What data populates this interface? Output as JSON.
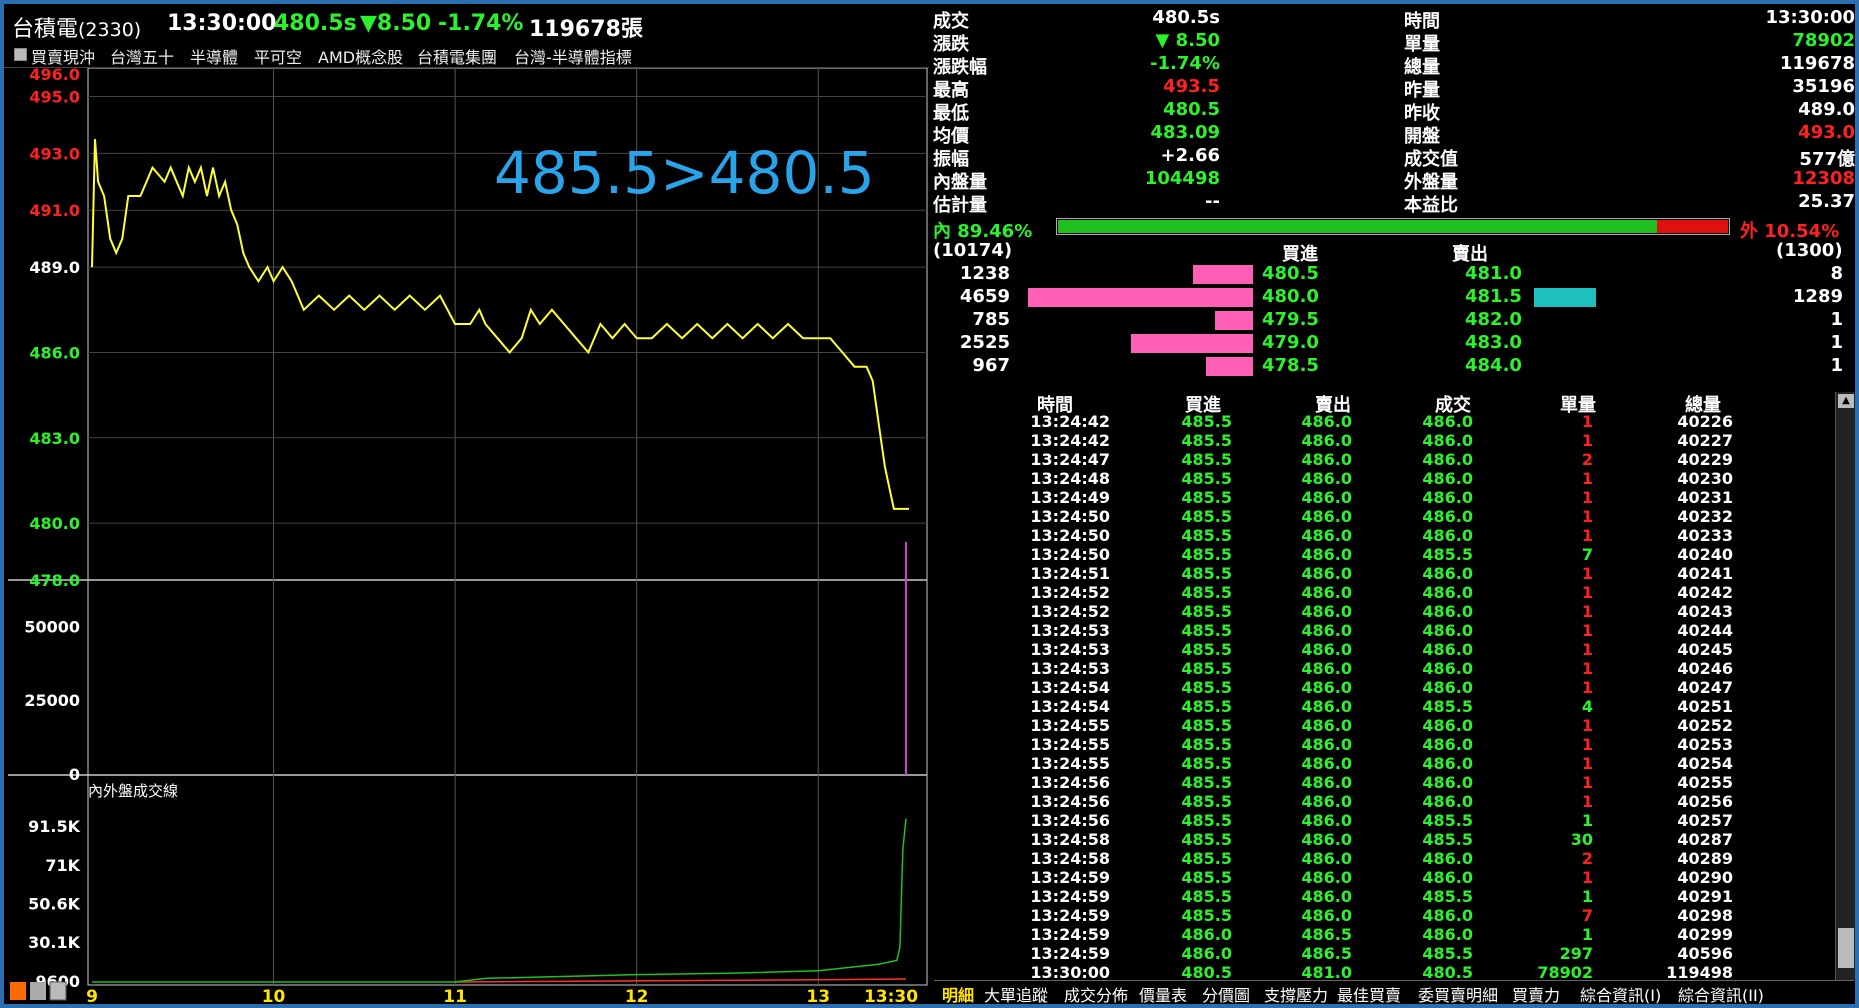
{
  "header": {
    "name": "台積電",
    "code": "(2330)",
    "time": "13:30:00",
    "price": "480.5s",
    "change": "▼8.50",
    "pct": "-1.74%",
    "volume": "119678張"
  },
  "tags": [
    "買賣現沖",
    "台灣五十",
    "半導體",
    "平可空",
    "AMD概念股",
    "台積電集團",
    "台灣-半導體指標"
  ],
  "annotation": "485.5>480.5",
  "price_axis": [
    "496.0",
    "495.0",
    "493.0",
    "491.0",
    "489.0",
    "486.0",
    "483.0",
    "480.0",
    "478.0"
  ],
  "volume_axis": [
    "50000",
    "25000",
    "0"
  ],
  "flow_axis": [
    "91.5K",
    "71K",
    "50.6K",
    "30.1K",
    "9600"
  ],
  "flow_title": "內外盤成交線",
  "time_axis": [
    "9",
    "10",
    "11",
    "12",
    "13",
    "13:30"
  ],
  "chart_data": {
    "type": "line",
    "price_line": [
      [
        "09:00",
        489.0
      ],
      [
        "09:01",
        493.5
      ],
      [
        "09:02",
        492.0
      ],
      [
        "09:04",
        491.5
      ],
      [
        "09:06",
        490.0
      ],
      [
        "09:08",
        489.5
      ],
      [
        "09:10",
        490.0
      ],
      [
        "09:12",
        491.5
      ],
      [
        "09:16",
        491.5
      ],
      [
        "09:18",
        492.0
      ],
      [
        "09:20",
        492.5
      ],
      [
        "09:24",
        492.0
      ],
      [
        "09:26",
        492.5
      ],
      [
        "09:28",
        492.0
      ],
      [
        "09:30",
        491.5
      ],
      [
        "09:32",
        492.5
      ],
      [
        "09:34",
        492.0
      ],
      [
        "09:36",
        492.5
      ],
      [
        "09:38",
        491.5
      ],
      [
        "09:40",
        492.5
      ],
      [
        "09:42",
        491.5
      ],
      [
        "09:44",
        492.0
      ],
      [
        "09:46",
        491.0
      ],
      [
        "09:48",
        490.5
      ],
      [
        "09:50",
        489.5
      ],
      [
        "09:52",
        489.0
      ],
      [
        "09:55",
        488.5
      ],
      [
        "09:58",
        489.0
      ],
      [
        "10:00",
        488.5
      ],
      [
        "10:03",
        489.0
      ],
      [
        "10:06",
        488.5
      ],
      [
        "10:08",
        488.0
      ],
      [
        "10:10",
        487.5
      ],
      [
        "10:15",
        488.0
      ],
      [
        "10:20",
        487.5
      ],
      [
        "10:25",
        488.0
      ],
      [
        "10:30",
        487.5
      ],
      [
        "10:35",
        488.0
      ],
      [
        "10:40",
        487.5
      ],
      [
        "10:45",
        488.0
      ],
      [
        "10:50",
        487.5
      ],
      [
        "10:55",
        488.0
      ],
      [
        "11:00",
        487.0
      ],
      [
        "11:05",
        487.0
      ],
      [
        "11:08",
        487.5
      ],
      [
        "11:10",
        487.0
      ],
      [
        "11:14",
        486.5
      ],
      [
        "11:18",
        486.0
      ],
      [
        "11:22",
        486.5
      ],
      [
        "11:25",
        487.5
      ],
      [
        "11:28",
        487.0
      ],
      [
        "11:32",
        487.5
      ],
      [
        "11:36",
        487.0
      ],
      [
        "11:40",
        486.5
      ],
      [
        "11:44",
        486.0
      ],
      [
        "11:48",
        487.0
      ],
      [
        "11:52",
        486.5
      ],
      [
        "11:56",
        487.0
      ],
      [
        "12:00",
        486.5
      ],
      [
        "12:05",
        486.5
      ],
      [
        "12:10",
        487.0
      ],
      [
        "12:15",
        486.5
      ],
      [
        "12:20",
        487.0
      ],
      [
        "12:25",
        486.5
      ],
      [
        "12:30",
        487.0
      ],
      [
        "12:35",
        486.5
      ],
      [
        "12:40",
        487.0
      ],
      [
        "12:45",
        486.5
      ],
      [
        "12:50",
        487.0
      ],
      [
        "12:55",
        486.5
      ],
      [
        "13:00",
        486.5
      ],
      [
        "13:04",
        486.5
      ],
      [
        "13:08",
        486.0
      ],
      [
        "13:12",
        485.5
      ],
      [
        "13:16",
        485.5
      ],
      [
        "13:18",
        485.0
      ],
      [
        "13:20",
        483.5
      ],
      [
        "13:22",
        482.0
      ],
      [
        "13:24",
        481.0
      ],
      [
        "13:25",
        480.5
      ],
      [
        "13:30",
        480.5
      ]
    ],
    "final_volume_bar": 78902,
    "flow": {
      "inner_final": 104498,
      "outer_final": 12308
    }
  },
  "quote": {
    "rows": [
      {
        "l1": "成交",
        "v1": "480.5s",
        "c1": "white",
        "l2": "時間",
        "v2": "13:30:00",
        "c2": "white"
      },
      {
        "l1": "漲跌",
        "v1": "▼ 8.50",
        "c1": "green",
        "l2": "單量",
        "v2": "78902",
        "c2": "green"
      },
      {
        "l1": "漲跌幅",
        "v1": "-1.74%",
        "c1": "green",
        "l2": "總量",
        "v2": "119678",
        "c2": "white"
      },
      {
        "l1": "最高",
        "v1": "493.5",
        "c1": "red",
        "l2": "昨量",
        "v2": "35196",
        "c2": "white"
      },
      {
        "l1": "最低",
        "v1": "480.5",
        "c1": "green",
        "l2": "昨收",
        "v2": "489.0",
        "c2": "white"
      },
      {
        "l1": "均價",
        "v1": "483.09",
        "c1": "green",
        "l2": "開盤",
        "v2": "493.0",
        "c2": "red"
      },
      {
        "l1": "振幅",
        "v1": "+2.66",
        "c1": "white",
        "l2": "成交值",
        "v2": "577億",
        "c2": "white"
      },
      {
        "l1": "內盤量",
        "v1": "104498",
        "c1": "green",
        "l2": "外盤量",
        "v2": "12308",
        "c2": "red"
      },
      {
        "l1": "估計量",
        "v1": "--",
        "c1": "white",
        "l2": "本益比",
        "v2": "25.37",
        "c2": "white"
      }
    ],
    "inner_label": "內 89.46%",
    "outer_label": "外  10.54%",
    "inner_ratio": 0.8946
  },
  "book": {
    "bid_total": "(10174)",
    "ask_total": "(1300)",
    "bid_header": "買進",
    "ask_header": "賣出",
    "levels": [
      {
        "bq": "1238",
        "bp": "480.5",
        "ap": "481.0",
        "aq": "8",
        "bqn": 1238,
        "aqn": 8
      },
      {
        "bq": "4659",
        "bp": "480.0",
        "ap": "481.5",
        "aq": "1289",
        "bqn": 4659,
        "aqn": 1289
      },
      {
        "bq": "785",
        "bp": "479.5",
        "ap": "482.0",
        "aq": "1",
        "bqn": 785,
        "aqn": 1
      },
      {
        "bq": "2525",
        "bp": "479.0",
        "ap": "483.0",
        "aq": "1",
        "bqn": 2525,
        "aqn": 1
      },
      {
        "bq": "967",
        "bp": "478.5",
        "ap": "484.0",
        "aq": "1",
        "bqn": 967,
        "aqn": 1
      }
    ]
  },
  "ticks": {
    "headers": [
      "時間",
      "買進",
      "賣出",
      "成交",
      "單量",
      "總量"
    ],
    "rows": [
      [
        "13:24:42",
        "485.5",
        "486.0",
        "486.0",
        "1",
        "40226"
      ],
      [
        "13:24:42",
        "485.5",
        "486.0",
        "486.0",
        "1",
        "40227"
      ],
      [
        "13:24:47",
        "485.5",
        "486.0",
        "486.0",
        "2",
        "40229"
      ],
      [
        "13:24:48",
        "485.5",
        "486.0",
        "486.0",
        "1",
        "40230"
      ],
      [
        "13:24:49",
        "485.5",
        "486.0",
        "486.0",
        "1",
        "40231"
      ],
      [
        "13:24:50",
        "485.5",
        "486.0",
        "486.0",
        "1",
        "40232"
      ],
      [
        "13:24:50",
        "485.5",
        "486.0",
        "486.0",
        "1",
        "40233"
      ],
      [
        "13:24:50",
        "485.5",
        "486.0",
        "485.5",
        "7",
        "40240"
      ],
      [
        "13:24:51",
        "485.5",
        "486.0",
        "486.0",
        "1",
        "40241"
      ],
      [
        "13:24:52",
        "485.5",
        "486.0",
        "486.0",
        "1",
        "40242"
      ],
      [
        "13:24:52",
        "485.5",
        "486.0",
        "486.0",
        "1",
        "40243"
      ],
      [
        "13:24:53",
        "485.5",
        "486.0",
        "486.0",
        "1",
        "40244"
      ],
      [
        "13:24:53",
        "485.5",
        "486.0",
        "486.0",
        "1",
        "40245"
      ],
      [
        "13:24:53",
        "485.5",
        "486.0",
        "486.0",
        "1",
        "40246"
      ],
      [
        "13:24:54",
        "485.5",
        "486.0",
        "486.0",
        "1",
        "40247"
      ],
      [
        "13:24:54",
        "485.5",
        "486.0",
        "485.5",
        "4",
        "40251"
      ],
      [
        "13:24:55",
        "485.5",
        "486.0",
        "486.0",
        "1",
        "40252"
      ],
      [
        "13:24:55",
        "485.5",
        "486.0",
        "486.0",
        "1",
        "40253"
      ],
      [
        "13:24:55",
        "485.5",
        "486.0",
        "486.0",
        "1",
        "40254"
      ],
      [
        "13:24:56",
        "485.5",
        "486.0",
        "486.0",
        "1",
        "40255"
      ],
      [
        "13:24:56",
        "485.5",
        "486.0",
        "486.0",
        "1",
        "40256"
      ],
      [
        "13:24:56",
        "485.5",
        "486.0",
        "485.5",
        "1",
        "40257"
      ],
      [
        "13:24:58",
        "485.5",
        "486.0",
        "485.5",
        "30",
        "40287"
      ],
      [
        "13:24:58",
        "485.5",
        "486.0",
        "486.0",
        "2",
        "40289"
      ],
      [
        "13:24:59",
        "485.5",
        "486.0",
        "486.0",
        "1",
        "40290"
      ],
      [
        "13:24:59",
        "485.5",
        "486.0",
        "485.5",
        "1",
        "40291"
      ],
      [
        "13:24:59",
        "485.5",
        "486.0",
        "486.0",
        "7",
        "40298"
      ],
      [
        "13:24:59",
        "486.0",
        "486.5",
        "486.0",
        "1",
        "40299"
      ],
      [
        "13:24:59",
        "486.0",
        "486.5",
        "485.5",
        "297",
        "40596"
      ],
      [
        "13:30:00",
        "480.5",
        "481.0",
        "480.5",
        "78902",
        "119498"
      ]
    ],
    "qty_colors": [
      "red",
      "red",
      "red",
      "red",
      "red",
      "red",
      "red",
      "green",
      "red",
      "red",
      "red",
      "red",
      "red",
      "red",
      "red",
      "green",
      "red",
      "red",
      "red",
      "red",
      "red",
      "green",
      "green",
      "red",
      "red",
      "green",
      "red",
      "green",
      "green",
      "green"
    ]
  },
  "tabs": [
    "明細",
    "大單追蹤",
    "成交分佈",
    "價量表",
    "分價圖",
    "支撐壓力",
    "最佳買賣",
    "委買賣明細",
    "買賣力",
    "綜合資訊(I)",
    "綜合資訊(II)"
  ],
  "colors": {
    "up": "#ff2020",
    "down": "#2cf22c",
    "price_line": "#ffff33",
    "annotation": "#29a3ea",
    "bid_bar": "#ff5fb4",
    "ask_bar": "#1fbfbf"
  },
  "icons": [
    "home-icon",
    "print-icon",
    "window-icon",
    "refresh-icon"
  ]
}
